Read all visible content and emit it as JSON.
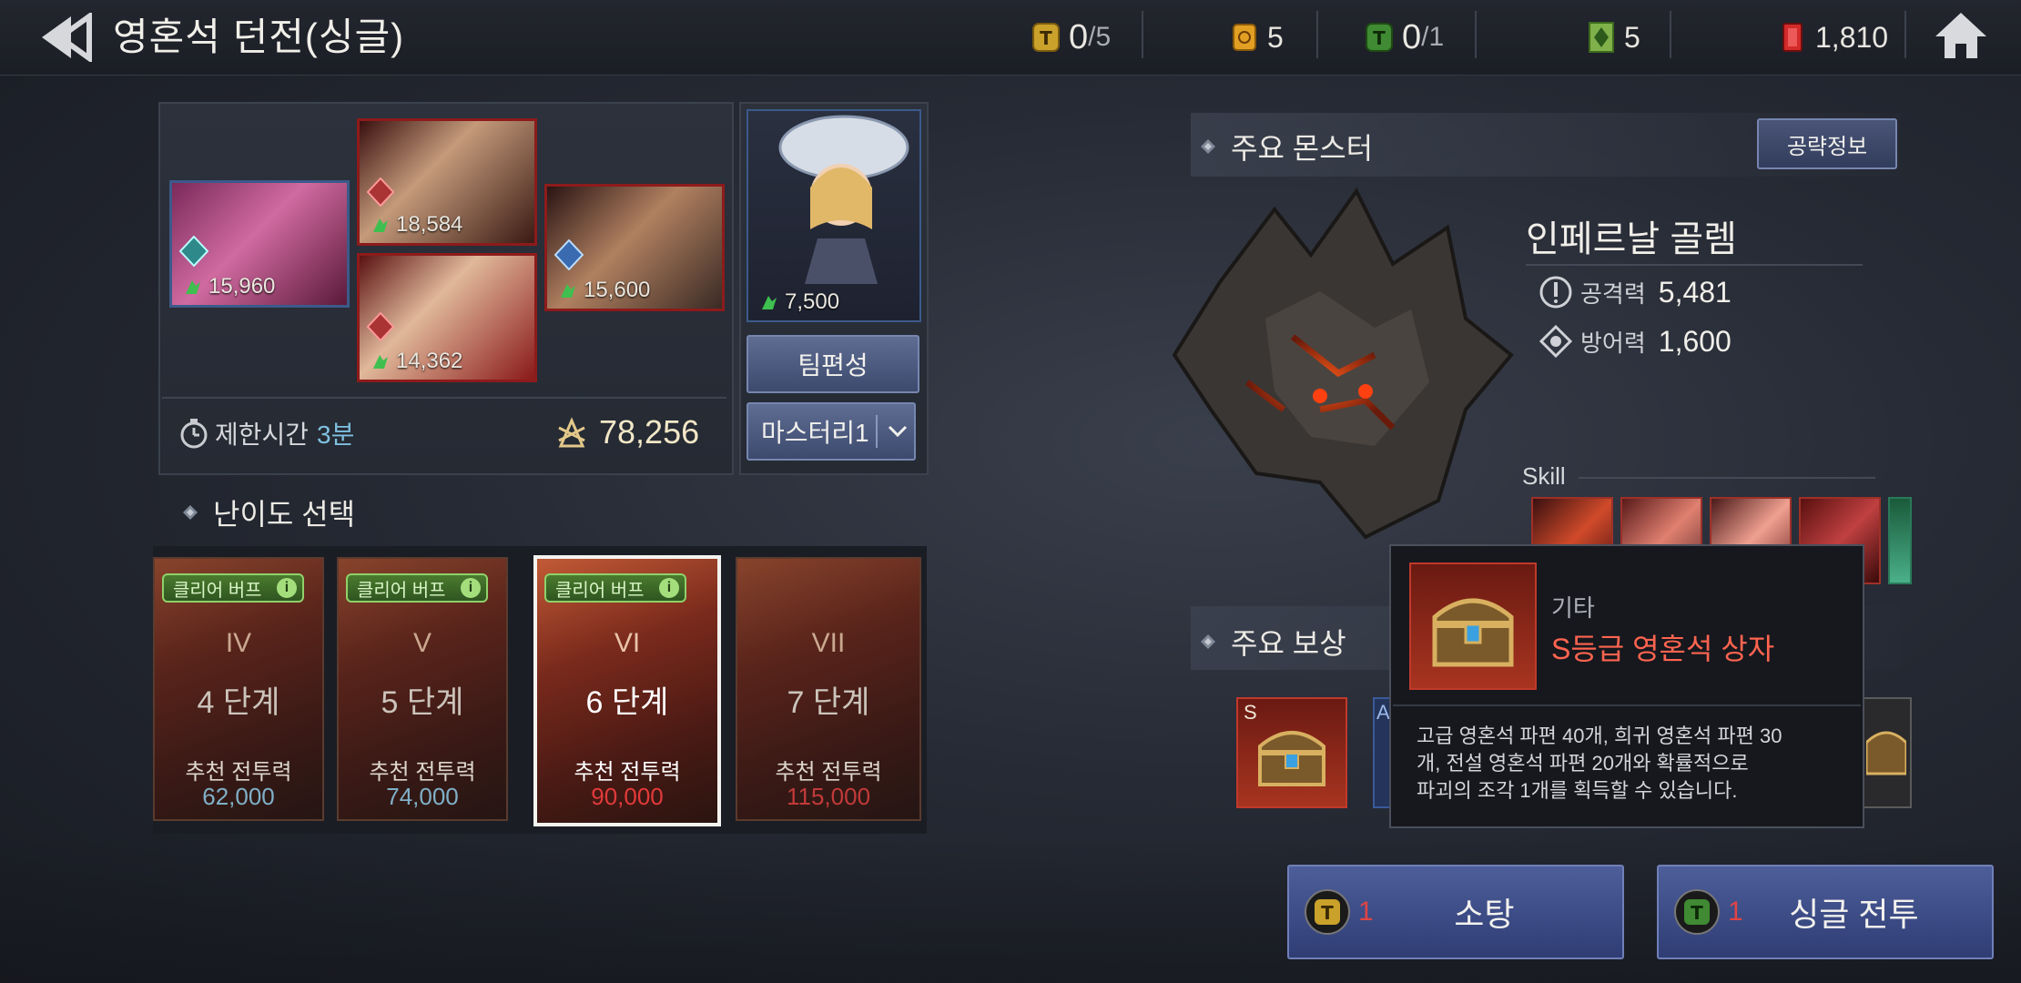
{
  "header": {
    "title": "영혼석 던전(싱글)",
    "currencies": [
      {
        "name": "dungeon-ticket",
        "value": "0",
        "max": "/5",
        "color": "#d8a92c"
      },
      {
        "name": "stamina-potion",
        "value": "5",
        "color": "#e0a020"
      },
      {
        "name": "green-ticket",
        "value": "0",
        "max": "/1",
        "color": "#4f9a3c"
      },
      {
        "name": "soul-shard",
        "value": "5",
        "color": "#7fb04a"
      },
      {
        "name": "ruby",
        "value": "1,810",
        "color": "#d93232"
      }
    ]
  },
  "team": {
    "heroes": [
      {
        "cp": "15,960"
      },
      {
        "cp": "18,584"
      },
      {
        "cp": "14,362"
      },
      {
        "cp": "15,600"
      }
    ],
    "pet_cp": "7,500",
    "time_label": "제한시간",
    "time_value": "3분",
    "total_cp": "78,256",
    "formation_btn": "팀편성",
    "mastery_btn": "마스터리1"
  },
  "difficulty": {
    "title": "난이도 선택",
    "buff_label": "클리어 버프",
    "rec_label": "추천 전투력",
    "levels": [
      {
        "roman": "IV",
        "label": "4 단계",
        "power": "62,000",
        "color": "#7fb0c8"
      },
      {
        "roman": "V",
        "label": "5 단계",
        "power": "74,000",
        "color": "#7fb0c8"
      },
      {
        "roman": "VI",
        "label": "6 단계",
        "power": "90,000",
        "color": "#e23a3a"
      },
      {
        "roman": "VII",
        "label": "7 단계",
        "power": "115,000",
        "color": "#c23a3a"
      }
    ],
    "selected_index": 2
  },
  "monster": {
    "section_title": "주요 몬스터",
    "guide_btn": "공략정보",
    "name": "인페르날 골렘",
    "attack_label": "공격력",
    "attack": "5,481",
    "defense_label": "방어력",
    "defense": "1,600",
    "skill_label": "Skill"
  },
  "reward": {
    "section_title": "주요 보상",
    "s_badge": "S",
    "a_badge": "A"
  },
  "tooltip": {
    "category": "기타",
    "name": "S등급 영혼석 상자",
    "desc_1": "고급 영혼석 파편 40개, 희귀 영혼석 파편 30",
    "desc_2": "개, 전설 영혼석 파편 20개와 확률적으로",
    "desc_3": "파괴의 조각 1개를 획득할 수 있습니다."
  },
  "actions": {
    "sweep_count": "1",
    "sweep_label": "소탕",
    "battle_count": "1",
    "battle_label": "싱글 전투"
  }
}
